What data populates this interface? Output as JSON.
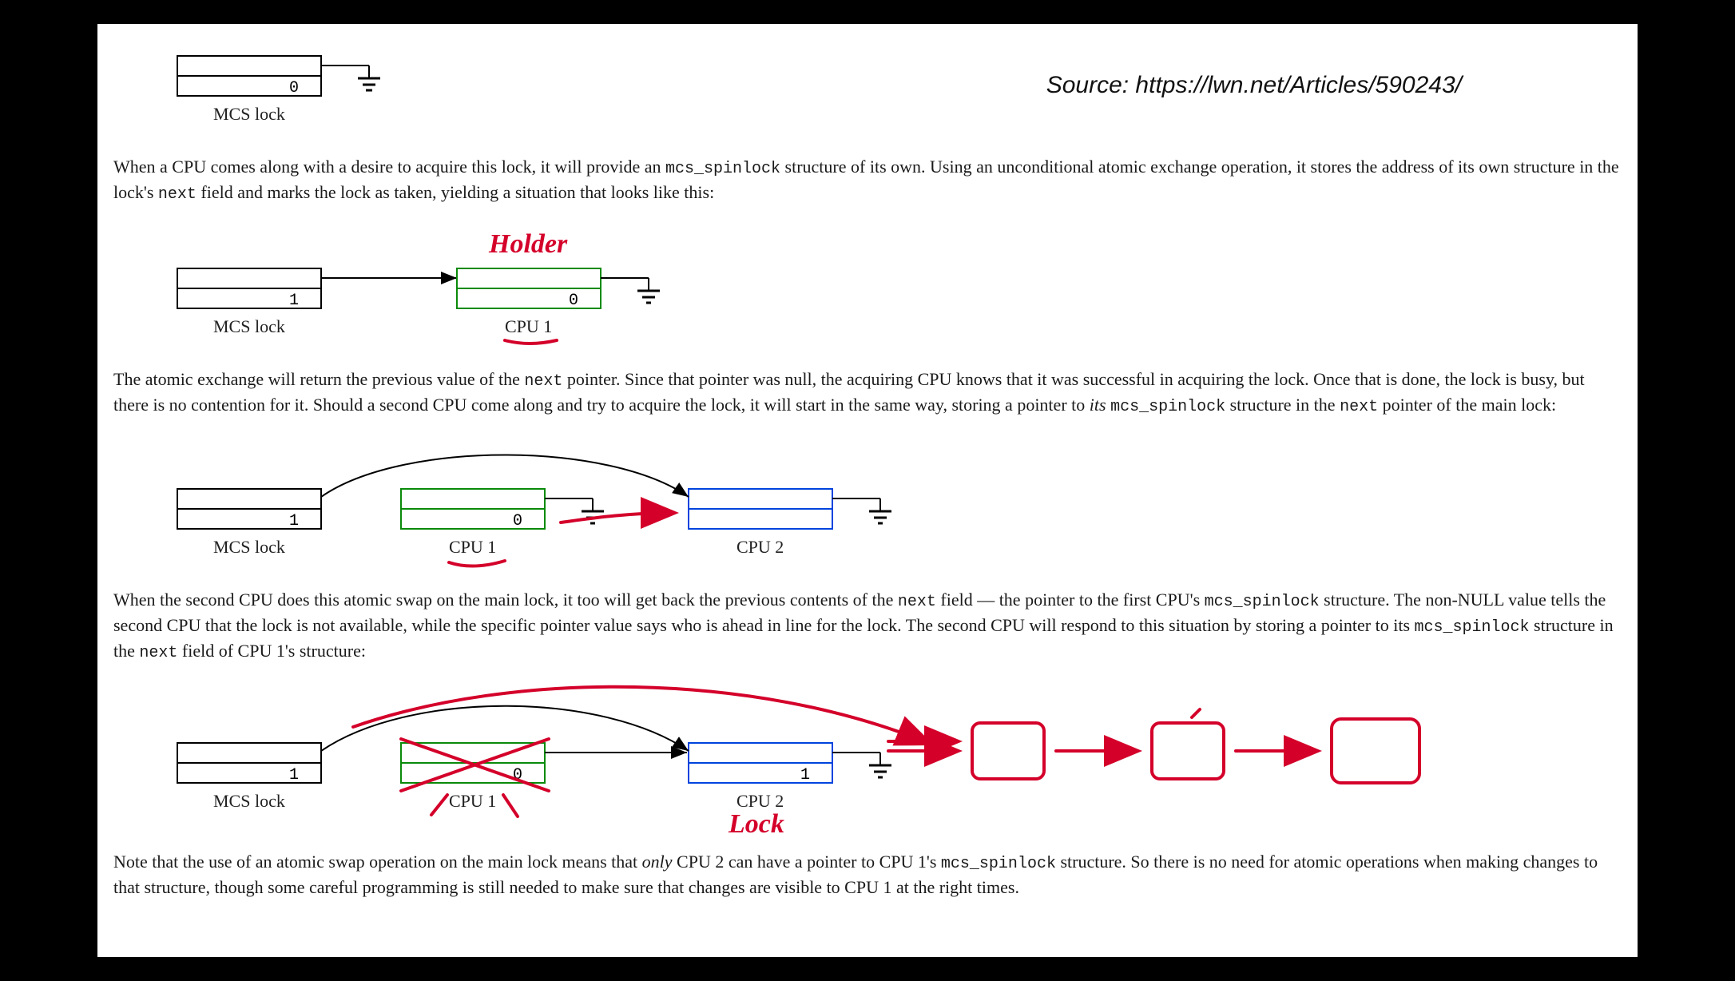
{
  "source_line": "Source: https://lwn.net/Articles/590243/",
  "diagram1": {
    "mcs_value": "0",
    "mcs_label": "MCS lock"
  },
  "para1_a": "When a CPU comes along with a desire to acquire this lock, it will provide an ",
  "para1_code": "mcs_spinlock",
  "para1_b": " structure of its own. Using an unconditional atomic exchange operation, it stores the address of its own structure in the lock's ",
  "para1_code2": "next",
  "para1_c": " field and marks the lock as taken, yielding a situation that looks like this:",
  "diagram2": {
    "mcs_value": "1",
    "mcs_label": "MCS lock",
    "cpu1_value": "0",
    "cpu1_label": "CPU 1",
    "annotation_holder": "Holder"
  },
  "para2_a": "The atomic exchange will return the previous value of the ",
  "para2_code1": "next",
  "para2_b": " pointer. Since that pointer was null, the acquiring CPU knows that it was successful in acquiring the lock. Once that is done, the lock is busy, but there is no contention for it. Should a second CPU come along and try to acquire the lock, it will start in the same way, storing a pointer to ",
  "para2_em": "its",
  "para2_c": " ",
  "para2_code2": "mcs_spinlock",
  "para2_d": " structure in the ",
  "para2_code3": "next",
  "para2_e": " pointer of the main lock:",
  "diagram3": {
    "mcs_value": "1",
    "mcs_label": "MCS lock",
    "cpu1_value": "0",
    "cpu1_label": "CPU 1",
    "cpu2_label": "CPU 2"
  },
  "para3_a": "When the second CPU does this atomic swap on the main lock, it too will get back the previous contents of the ",
  "para3_code1": "next",
  "para3_b": " field — the pointer to the first CPU's ",
  "para3_code2": "mcs_spinlock",
  "para3_c": " structure. The non-NULL value tells the second CPU that the lock is not available, while the specific pointer value says who is ahead in line for the lock. The second CPU will respond to this situation by storing a pointer to its ",
  "para3_code3": "mcs_spinlock",
  "para3_d": " structure in the ",
  "para3_code4": "next",
  "para3_e": " field of CPU 1's structure:",
  "diagram4": {
    "mcs_value": "1",
    "mcs_label": "MCS lock",
    "cpu1_value": "0",
    "cpu1_label": "CPU 1",
    "cpu2_value": "1",
    "cpu2_label": "CPU 2",
    "annotation_lock": "Lock"
  },
  "para4_a": "Note that the use of an atomic swap operation on the main lock means that ",
  "para4_em": "only",
  "para4_b": " CPU 2 can have a pointer to CPU 1's ",
  "para4_code1": "mcs_spinlock",
  "para4_c": " structure. So there is no need for atomic operations when making changes to that structure, though some careful programming is still needed to make sure that changes are visible to CPU 1 at the right times."
}
